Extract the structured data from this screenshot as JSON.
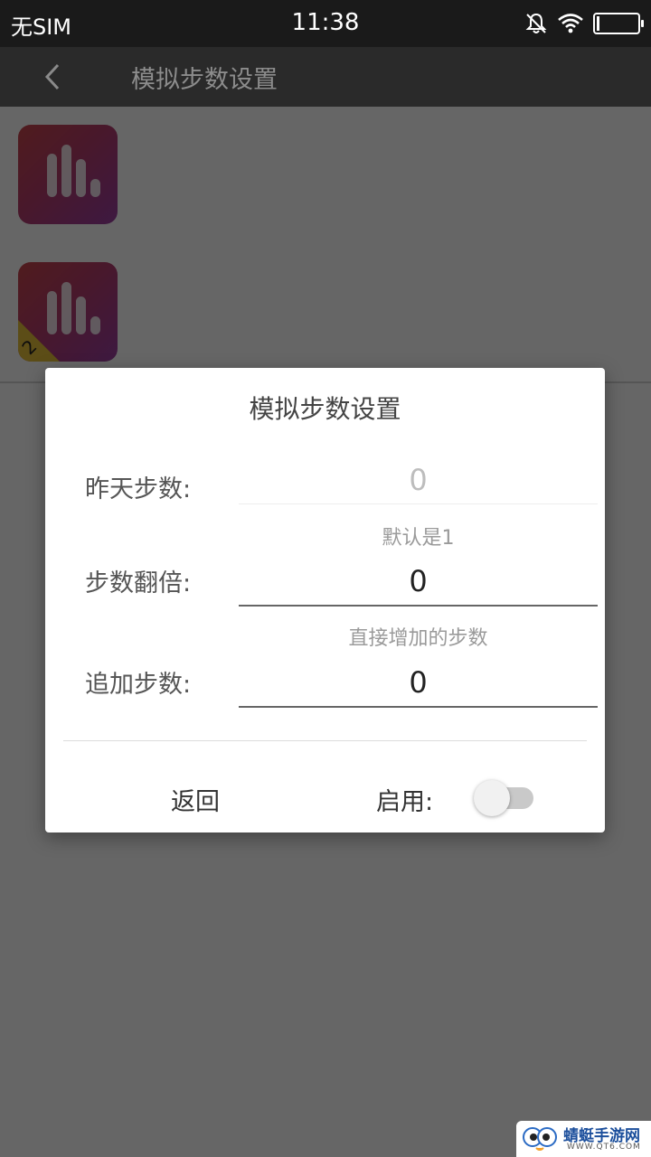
{
  "status_bar": {
    "carrier": "无SIM",
    "time": "11:38",
    "icons": [
      "mute-bell-icon",
      "wifi-icon",
      "battery-icon"
    ]
  },
  "app_bar": {
    "back_icon": "chevron-left-icon",
    "title": "模拟步数设置"
  },
  "list": {
    "items": [
      {
        "icon": "bar-chart-app-icon"
      },
      {
        "icon": "bar-chart-app-icon",
        "badge": "2"
      }
    ]
  },
  "dialog": {
    "title": "模拟步数设置",
    "fields": [
      {
        "label": "昨天步数:",
        "value": "0",
        "hint": "",
        "enabled": false
      },
      {
        "label": "步数翻倍:",
        "value": "0",
        "hint": "默认是1",
        "enabled": true
      },
      {
        "label": "追加步数:",
        "value": "0",
        "hint": "直接增加的步数",
        "enabled": true
      }
    ],
    "back_button": "返回",
    "enable_label": "启用:",
    "enable_toggle_on": false
  },
  "watermark": {
    "text": "蜻蜓手游网",
    "sub": "WWW.QT6.COM"
  },
  "colors": {
    "status_bar_bg": "#1a1a1a",
    "app_bar_bg": "#2a2a2a",
    "icon_gradient_start": "#c8464b",
    "icon_gradient_end": "#9a3fa3",
    "badge": "#e6c03a"
  }
}
